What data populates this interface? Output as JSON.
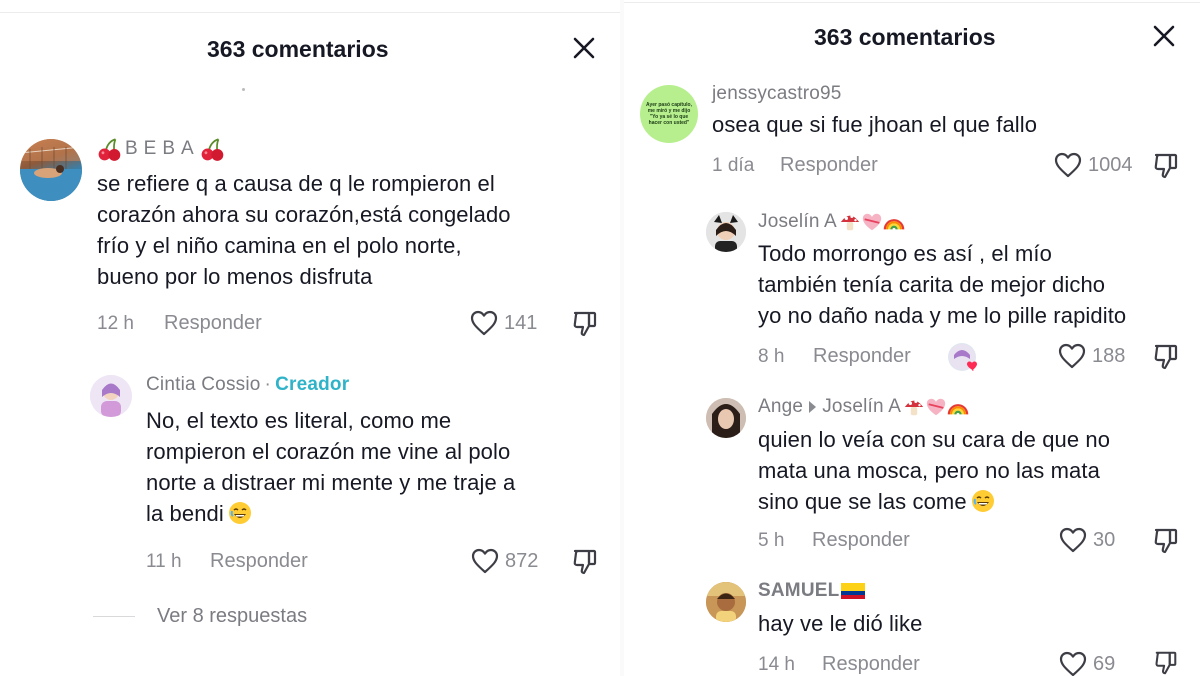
{
  "left": {
    "title": "363 comentarios",
    "comments": [
      {
        "user": "BEBA",
        "lines": [
          "se refiere q a causa de q le rompieron el",
          "corazón ahora su corazón,está congelado",
          "frío y el niño camina en el polo norte,",
          "bueno por lo menos disfruta"
        ],
        "time": "12 h",
        "reply": "Responder",
        "likes": "141"
      },
      {
        "user": "Cintia Cossio",
        "badge": "Creador",
        "lines": [
          "No, el texto es literal, como me",
          "rompieron el corazón me vine al polo",
          "norte a distraer mi mente y me traje a",
          "la bendi"
        ],
        "time": "11 h",
        "reply": "Responder",
        "likes": "872"
      }
    ],
    "view_replies": "Ver 8 respuestas"
  },
  "right": {
    "title": "363 comentarios",
    "comments": [
      {
        "user": "jenssycastro95",
        "avatar_text": "Ayer pasó capítulo, me miró y me dijo \"Yo ya sé lo que hacer con usted\"",
        "lines": [
          "osea que si fue jhoan el que fallo"
        ],
        "time": "1 día",
        "reply": "Responder",
        "likes": "1004"
      },
      {
        "user": "Joselín A",
        "lines": [
          "Todo morrongo es así , el mío",
          "también tenía carita de mejor dicho",
          "yo no daño nada y me lo pille rapidito"
        ],
        "time": "8 h",
        "reply": "Responder",
        "likes": "188"
      },
      {
        "user": "Ange",
        "reply_to": "Joselín A",
        "lines": [
          "quien lo veía con su cara de que no",
          "mata una mosca, pero no las mata",
          "sino que se las come"
        ],
        "time": "5 h",
        "reply": "Responder",
        "likes": "30"
      },
      {
        "user": "SAMUEL",
        "lines": [
          "hay ve le dió like"
        ],
        "time": "14 h",
        "reply": "Responder",
        "likes": "69"
      }
    ]
  },
  "colors": {
    "text": "#161823",
    "muted": "#8a8b91",
    "creator": "#2fb3c8",
    "avatar_green": "#b7ef8f"
  },
  "icons": [
    "close-icon",
    "heart-icon",
    "dislike-icon",
    "cherry-icon",
    "mushroom-icon",
    "heart-ribbon-icon",
    "rainbow-icon",
    "laugh-emoji-icon",
    "colombia-flag-icon"
  ]
}
